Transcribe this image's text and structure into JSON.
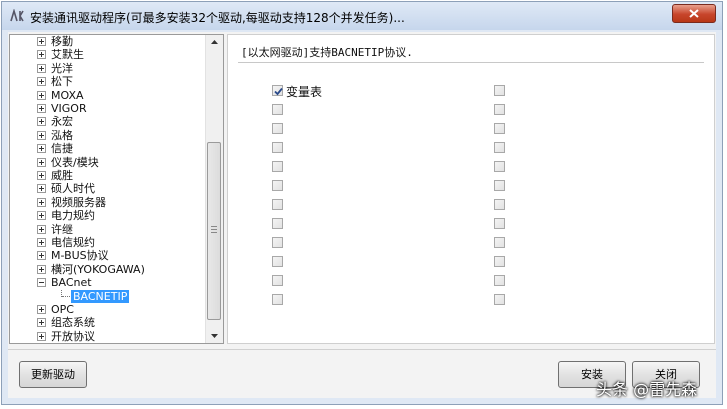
{
  "window": {
    "title": "安装通讯驱动程序(可最多安装32个驱动,每驱动支持128个并发任务)..."
  },
  "tree": {
    "items": [
      {
        "label": "移勤",
        "expanded": false
      },
      {
        "label": "艾默生",
        "expanded": false
      },
      {
        "label": "光洋",
        "expanded": false
      },
      {
        "label": "松下",
        "expanded": false
      },
      {
        "label": "MOXA",
        "expanded": false
      },
      {
        "label": "VIGOR",
        "expanded": false
      },
      {
        "label": "永宏",
        "expanded": false
      },
      {
        "label": "泓格",
        "expanded": false
      },
      {
        "label": "信捷",
        "expanded": false
      },
      {
        "label": "仪表/模块",
        "expanded": false
      },
      {
        "label": "威胜",
        "expanded": false
      },
      {
        "label": "硕人时代",
        "expanded": false
      },
      {
        "label": "视频服务器",
        "expanded": false
      },
      {
        "label": "电力规约",
        "expanded": false
      },
      {
        "label": "许继",
        "expanded": false
      },
      {
        "label": "电信规约",
        "expanded": false
      },
      {
        "label": "M-BUS协议",
        "expanded": false
      },
      {
        "label": "横河(YOKOGAWA)",
        "expanded": false
      },
      {
        "label": "BACnet",
        "expanded": true
      },
      {
        "label": "BACNETIP",
        "child": true,
        "selected": true
      },
      {
        "label": "OPC",
        "expanded": false
      },
      {
        "label": "组态系统",
        "expanded": false
      },
      {
        "label": "开放协议",
        "expanded": false
      }
    ]
  },
  "panel": {
    "description": "[以太网驱动]支持BACNETIP协议.",
    "left_column": [
      {
        "label": "变量表",
        "checked": true
      },
      {
        "label": "",
        "checked": false
      },
      {
        "label": "",
        "checked": false
      },
      {
        "label": "",
        "checked": false
      },
      {
        "label": "",
        "checked": false
      },
      {
        "label": "",
        "checked": false
      },
      {
        "label": "",
        "checked": false
      },
      {
        "label": "",
        "checked": false
      },
      {
        "label": "",
        "checked": false
      },
      {
        "label": "",
        "checked": false
      },
      {
        "label": "",
        "checked": false
      },
      {
        "label": "",
        "checked": false
      }
    ],
    "right_column": [
      {
        "label": "",
        "checked": false
      },
      {
        "label": "",
        "checked": false
      },
      {
        "label": "",
        "checked": false
      },
      {
        "label": "",
        "checked": false
      },
      {
        "label": "",
        "checked": false
      },
      {
        "label": "",
        "checked": false
      },
      {
        "label": "",
        "checked": false
      },
      {
        "label": "",
        "checked": false
      },
      {
        "label": "",
        "checked": false
      },
      {
        "label": "",
        "checked": false
      },
      {
        "label": "",
        "checked": false
      },
      {
        "label": "",
        "checked": false
      }
    ]
  },
  "buttons": {
    "update_driver": "更新驱动",
    "install": "安装",
    "close": "关闭"
  },
  "watermark": {
    "text": "头条 @雷先森"
  },
  "colors": {
    "titlebar": "#c6d6ec",
    "selection": "#3399ff",
    "close_button": "#c7452b"
  }
}
